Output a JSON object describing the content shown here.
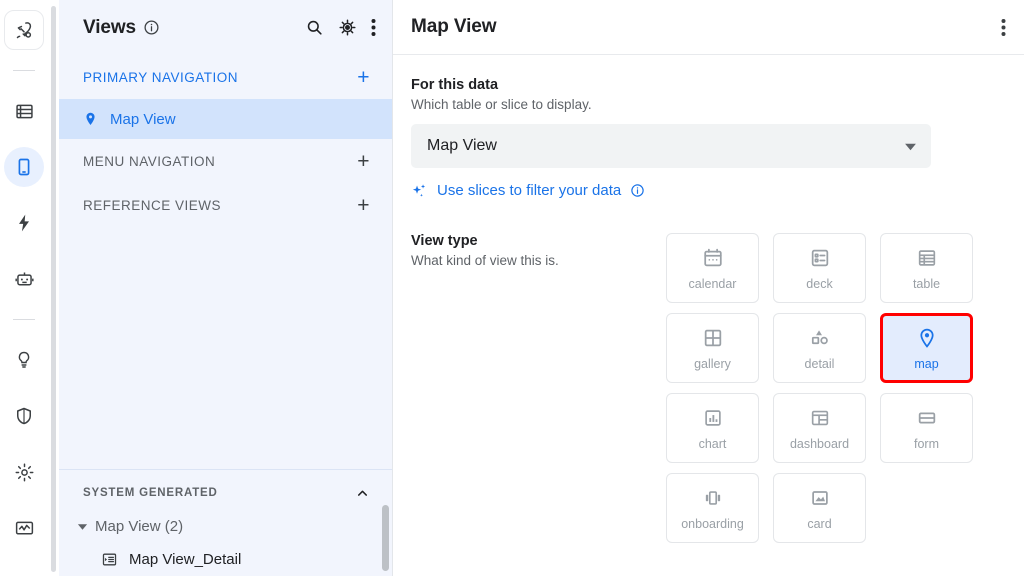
{
  "rail": {
    "items": [
      {
        "icon": "rocket-icon",
        "name": "rail-item-rocket",
        "state": "boxed"
      },
      {
        "icon": "database-icon",
        "name": "rail-item-data",
        "state": "normal"
      },
      {
        "icon": "mobile-icon",
        "name": "rail-item-app-views",
        "state": "active"
      },
      {
        "icon": "bolt-icon",
        "name": "rail-item-automation",
        "state": "normal"
      },
      {
        "icon": "robot-icon",
        "name": "rail-item-intelligence",
        "state": "normal"
      },
      {
        "icon": "lightbulb-icon",
        "name": "rail-item-ideas",
        "state": "normal"
      },
      {
        "icon": "shield-icon",
        "name": "rail-item-security",
        "state": "normal"
      },
      {
        "icon": "gear-icon",
        "name": "rail-item-settings",
        "state": "normal"
      },
      {
        "icon": "monitor-activity-icon",
        "name": "rail-item-monitor",
        "state": "normal"
      }
    ]
  },
  "sidebar": {
    "title": "Views",
    "info_icon": "info-circle-icon",
    "actions": [
      {
        "icon": "search-icon",
        "name": "sidebar-search-button"
      },
      {
        "icon": "gear-icon",
        "name": "sidebar-settings-button"
      },
      {
        "icon": "kebab-menu-icon",
        "name": "sidebar-more-button"
      }
    ],
    "sections": [
      {
        "label": "PRIMARY NAVIGATION",
        "accent": true,
        "add_label": "+"
      },
      {
        "label": "MENU NAVIGATION",
        "accent": false,
        "add_label": "+"
      },
      {
        "label": "REFERENCE VIEWS",
        "accent": false,
        "add_label": "+"
      }
    ],
    "primary_items": [
      {
        "label": "Map View",
        "icon": "map-pin-icon",
        "selected": true
      }
    ],
    "system_generated": {
      "label": "SYSTEM GENERATED",
      "collapse_icon": "chevron-up-icon",
      "group": {
        "label": "Map View (2)",
        "caret": "caret-down-icon"
      },
      "children": [
        {
          "label": "Map View_Detail",
          "icon": "detail-view-icon"
        }
      ]
    }
  },
  "main": {
    "title": "Map View",
    "kebab_icon": "kebab-menu-icon",
    "for_this_data": {
      "label": "For this data",
      "sublabel": "Which table or slice to display.",
      "selected_value": "Map View",
      "dropdown_icon": "caret-down-icon"
    },
    "slices_link": {
      "text": "Use slices to filter your data",
      "sparkle_icon": "sparkle-icon",
      "info_icon": "info-circle-icon"
    },
    "view_type": {
      "label": "View type",
      "sublabel": "What kind of view this is.",
      "tiles": [
        {
          "label": "calendar",
          "icon": "calendar-icon",
          "selected": false
        },
        {
          "label": "deck",
          "icon": "deck-icon",
          "selected": false
        },
        {
          "label": "table",
          "icon": "table-icon",
          "selected": false
        },
        {
          "label": "gallery",
          "icon": "gallery-icon",
          "selected": false
        },
        {
          "label": "detail",
          "icon": "detail-icon",
          "selected": false
        },
        {
          "label": "map",
          "icon": "map-pin-icon",
          "selected": true
        },
        {
          "label": "chart",
          "icon": "chart-icon",
          "selected": false
        },
        {
          "label": "dashboard",
          "icon": "dashboard-icon",
          "selected": false
        },
        {
          "label": "form",
          "icon": "form-icon",
          "selected": false
        },
        {
          "label": "onboarding",
          "icon": "onboarding-icon",
          "selected": false
        },
        {
          "label": "card",
          "icon": "card-icon",
          "selected": false
        }
      ]
    }
  },
  "colors": {
    "accent_blue": "#1a73e8",
    "selection_blue": "#d2e3fc",
    "highlight_red": "#ff0000",
    "sidebar_bg": "#f2f5fd",
    "field_gray": "#f1f3f4",
    "muted_text": "#9aa0a6"
  }
}
